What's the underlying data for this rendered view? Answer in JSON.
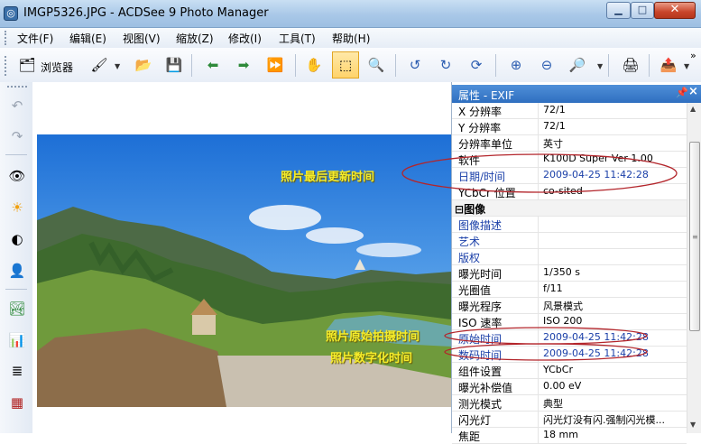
{
  "window": {
    "title": "IMGP5326.JPG - ACDSee 9 Photo Manager",
    "app_icon": "acdsee-app-icon",
    "minimize": "minimize-icon",
    "maximize": "maximize-icon",
    "close": "close-icon"
  },
  "menu": [
    "文件(F)",
    "编辑(E)",
    "视图(V)",
    "缩放(Z)",
    "修改(I)",
    "工具(T)",
    "帮助(H)"
  ],
  "toolbar": {
    "browse_label": "浏览器",
    "icons": [
      "browse-icon",
      "edit-brush-icon",
      "open-folder-icon",
      "save-icon",
      "previous-image-icon",
      "next-image-icon",
      "auto-advance-icon",
      "hand-pan-icon",
      "select-marquee-icon",
      "zoom-tool-icon",
      "rotate-left-icon",
      "rotate-right-icon",
      "fit-icon",
      "zoom-in-icon",
      "zoom-out-icon",
      "zoom-menu-icon",
      "print-icon",
      "export-icon",
      "more-icon"
    ]
  },
  "left_toolbar": {
    "icons": [
      "undo-icon",
      "redo-icon",
      "red-eye-icon",
      "exposure-sun-icon",
      "contrast-icon",
      "portrait-icon",
      "landscape-icon",
      "levels-chart-icon",
      "tone-curve-icon",
      "color-balance-icon"
    ]
  },
  "annotations": {
    "update_time": "照片最后更新时间",
    "original_time": "照片原始拍摄时间",
    "digitized_time": "照片数字化时间"
  },
  "panel": {
    "title": "属性 - EXIF",
    "pin_icon": "pin-icon",
    "close_icon": "close-icon",
    "rows_top": [
      {
        "key": "X 分辨率",
        "value": "72/1"
      },
      {
        "key": "Y 分辨率",
        "value": "72/1"
      },
      {
        "key": "分辨率单位",
        "value": "英寸"
      },
      {
        "key": "软件",
        "value": "K100D Super Ver 1.00"
      },
      {
        "key": "日期/时间",
        "value": "2009-04-25 11:42:28",
        "blue": true
      },
      {
        "key": "YCbCr 位置",
        "value": "co-sited"
      }
    ],
    "section_label": "图像",
    "section_toggle": "⊟",
    "rows_image": [
      {
        "key": "图像描述",
        "value": "",
        "blue": true
      },
      {
        "key": "艺术",
        "value": "",
        "blue": true
      },
      {
        "key": "版权",
        "value": "",
        "blue": true
      },
      {
        "key": "曝光时间",
        "value": "1/350 s"
      },
      {
        "key": "光圈值",
        "value": "f/11"
      },
      {
        "key": "曝光程序",
        "value": "风景模式"
      },
      {
        "key": "ISO 速率",
        "value": "ISO 200"
      },
      {
        "key": "原始时间",
        "value": "2009-04-25 11:42:28",
        "blue": true
      },
      {
        "key": "数码时间",
        "value": "2009-04-25 11:42:28",
        "blue": true
      },
      {
        "key": "组件设置",
        "value": "YCbCr"
      },
      {
        "key": "曝光补偿值",
        "value": "0.00 eV"
      },
      {
        "key": "测光模式",
        "value": "典型"
      },
      {
        "key": "闪光灯",
        "value": "闪光灯没有闪.强制闪光模..."
      },
      {
        "key": "焦距",
        "value": "18 mm"
      }
    ]
  },
  "colors": {
    "panel_header": "#2f6fc0",
    "blue_text": "#1a3fa8",
    "annotation_yellow": "#f5ec2a",
    "circle_red": "#b3252b"
  }
}
